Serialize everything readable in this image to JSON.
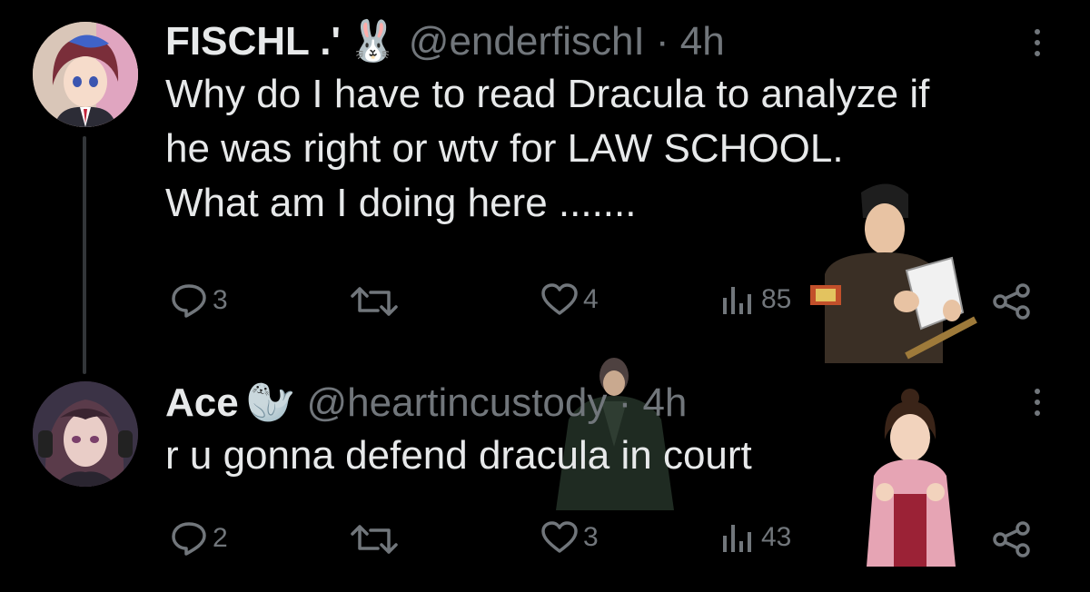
{
  "tweets": [
    {
      "name": "FISCHL .'",
      "name_emoji": "🐰",
      "handle_time": "@enderfischI · 4h",
      "text_lines": [
        "Why do I have to read Dracula to analyze if",
        "he was right or wtv for LAW SCHOOL.",
        "What am I doing here ......."
      ],
      "replies": "3",
      "likes": "4",
      "views": "85"
    },
    {
      "name": "Ace",
      "name_emoji": "🦭",
      "handle_time": "@heartincustody · 4h",
      "text_lines": [
        "r u gonna defend dracula in court"
      ],
      "replies": "2",
      "likes": "3",
      "views": "43"
    }
  ],
  "colors": {
    "background": "#000000",
    "text": "#e7e9ea",
    "muted": "#71767b",
    "thread_line": "#333639"
  },
  "icons": [
    "reply-icon",
    "retweet-icon",
    "like-icon",
    "views-icon",
    "share-icon",
    "more-icon"
  ]
}
